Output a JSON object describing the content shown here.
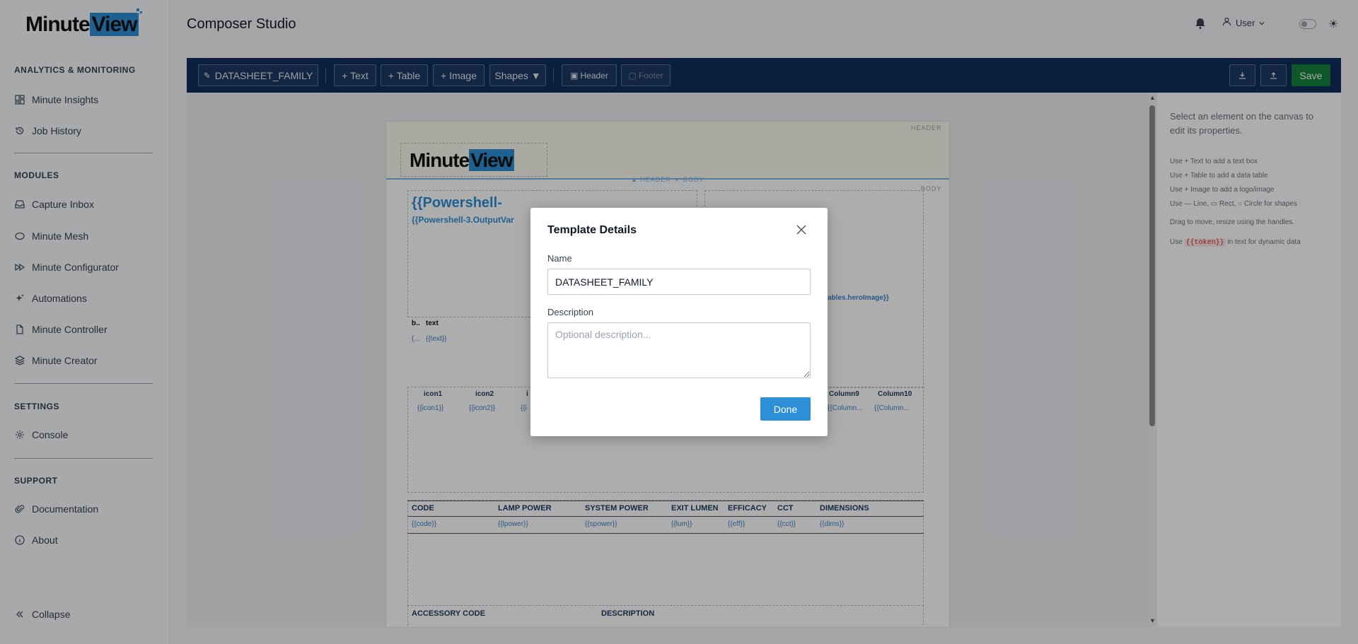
{
  "app": {
    "brand_prefix": "Minute",
    "brand_suffix": "View",
    "page_title": "Composer Studio"
  },
  "sidebar": {
    "sections": [
      {
        "title": "ANALYTICS & MONITORING",
        "items": [
          {
            "label": "Minute Insights",
            "icon": "dashboard-icon"
          },
          {
            "label": "Job History",
            "icon": "history-icon"
          }
        ]
      },
      {
        "title": "MODULES",
        "items": [
          {
            "label": "Capture Inbox",
            "icon": "inbox-icon"
          },
          {
            "label": "Minute Mesh",
            "icon": "mesh-icon"
          },
          {
            "label": "Minute Configurator",
            "icon": "fast-forward-icon"
          },
          {
            "label": "Automations",
            "icon": "sparkle-icon"
          },
          {
            "label": "Minute Controller",
            "icon": "document-icon"
          },
          {
            "label": "Minute Creator",
            "icon": "layers-icon"
          }
        ]
      },
      {
        "title": "SETTINGS",
        "items": [
          {
            "label": "Console",
            "icon": "gear-icon"
          }
        ]
      },
      {
        "title": "SUPPORT",
        "items": [
          {
            "label": "Documentation",
            "icon": "paperclip-icon"
          },
          {
            "label": "About",
            "icon": "info-icon"
          }
        ]
      }
    ],
    "collapse_label": "Collapse"
  },
  "header": {
    "user_label": "User"
  },
  "toolbar": {
    "template_name": "DATASHEET_FAMILY",
    "add_text": "+ Text",
    "add_table": "+ Table",
    "add_image": "+ Image",
    "shapes": "Shapes ▼",
    "header": "Header",
    "footer": "Footer",
    "save": "Save"
  },
  "properties": {
    "empty_title": "Select an element on the canvas to edit its properties.",
    "tips": [
      "Use + Text to add a text box",
      "Use + Table to add a data table",
      "Use + Image to add a logo/image",
      "Use — Line, ▭ Rect, ○ Circle for shapes",
      "Drag to move, resize using the handles."
    ],
    "token_tip_prefix": "Use",
    "token_tip_token": "{{token}}",
    "token_tip_suffix": "in text for dynamic data"
  },
  "canvas": {
    "header_tag": "HEADER",
    "body_tag": "BODY",
    "split_label": "▲ HEADER ▼ BODY",
    "hero_big": "{{Powershell-",
    "hero_small": "{{Powershell-3.OutputVar",
    "hero_image": "ables.heroImage}}",
    "text_label_a": "b..",
    "text_label_b": "text",
    "text_value_a": "{...",
    "text_value_b": "{{text}}",
    "icon_cols": [
      {
        "head": "icon1",
        "val": "{{icon1}}"
      },
      {
        "head": "icon2",
        "val": "{{icon2}}"
      },
      {
        "head": "i",
        "val": "{{i"
      },
      {
        "head": "Column9",
        "val": "{{Column..."
      },
      {
        "head": "Column10",
        "val": "{{Column..."
      }
    ],
    "spec_headers": [
      "CODE",
      "LAMP POWER",
      "SYSTEM POWER",
      "EXIT LUMEN",
      "EFFICACY",
      "CCT",
      "DIMENSIONS"
    ],
    "spec_values": [
      "{{code}}",
      "{{lpower}}",
      "{{spower}}",
      "{{lum}}",
      "{{eff}}",
      "{{cct}}",
      "{{dims}}"
    ],
    "accessory_headers": [
      "ACCESSORY CODE",
      "DESCRIPTION"
    ]
  },
  "modal": {
    "title": "Template Details",
    "name_label": "Name",
    "name_value": "DATASHEET_FAMILY",
    "description_label": "Description",
    "description_placeholder": "Optional description...",
    "done_label": "Done"
  },
  "colors": {
    "brand_blue": "#2d8fd6",
    "toolbar_bg": "#0f2e5b",
    "save_green": "#15803d"
  }
}
